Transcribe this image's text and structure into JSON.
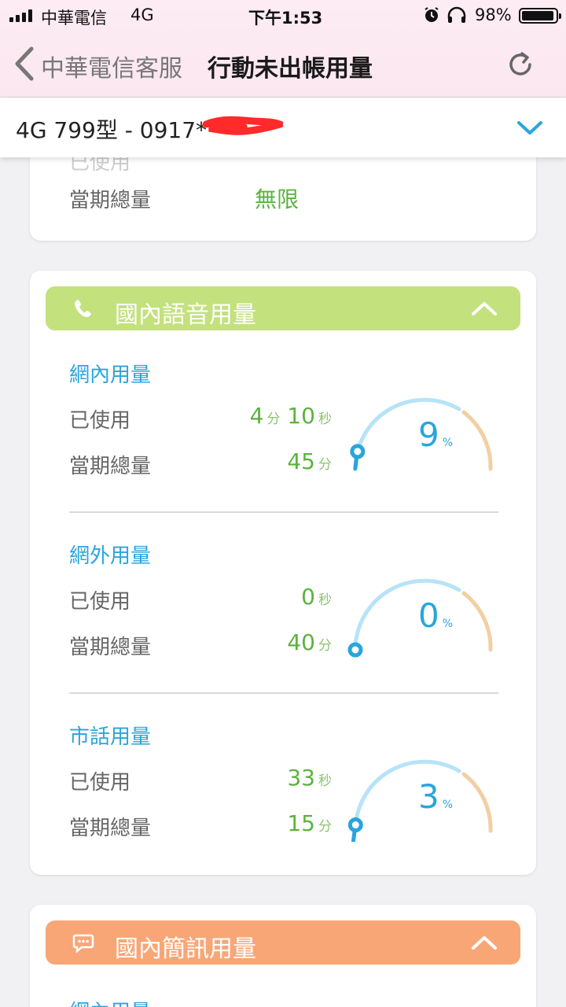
{
  "status_bar": {
    "carrier": "中華電信",
    "network": "4G",
    "time": "下午1:53",
    "battery": "98%"
  },
  "nav": {
    "back_label": "中華電信客服",
    "title": "行動未出帳用量"
  },
  "account": {
    "label": "4G 799型 - 0917*",
    "redaction_color": "#ff2a2a"
  },
  "data_card": {
    "used_label": "已使用",
    "total_label": "當期總量",
    "total_value": "無限"
  },
  "voice_card": {
    "title": "國內語音用量",
    "color": "#c3e17d",
    "sections": [
      {
        "title": "網內用量",
        "used_label": "已使用",
        "used": [
          {
            "n": "4",
            "u": "分"
          },
          {
            "n": "10",
            "u": "秒"
          }
        ],
        "total_label": "當期總量",
        "total": [
          {
            "n": "45",
            "u": "分"
          }
        ],
        "percent": "9",
        "percent_unit": "%",
        "fraction": 0.09
      },
      {
        "title": "網外用量",
        "used_label": "已使用",
        "used": [
          {
            "n": "0",
            "u": "秒"
          }
        ],
        "total_label": "當期總量",
        "total": [
          {
            "n": "40",
            "u": "分"
          }
        ],
        "percent": "0",
        "percent_unit": "%",
        "fraction": 0.0
      },
      {
        "title": "市話用量",
        "used_label": "已使用",
        "used": [
          {
            "n": "33",
            "u": "秒"
          }
        ],
        "total_label": "當期總量",
        "total": [
          {
            "n": "15",
            "u": "分"
          }
        ],
        "percent": "3",
        "percent_unit": "%",
        "fraction": 0.03
      }
    ]
  },
  "sms_card": {
    "title": "國內簡訊用量",
    "color": "#f9a677",
    "first_section": "網內用量"
  },
  "colors": {
    "accent_blue": "#29a5dc",
    "value_green": "#5bb33e",
    "gauge_track": "#b6e3f7",
    "gauge_warn": "#f2cfa3"
  }
}
